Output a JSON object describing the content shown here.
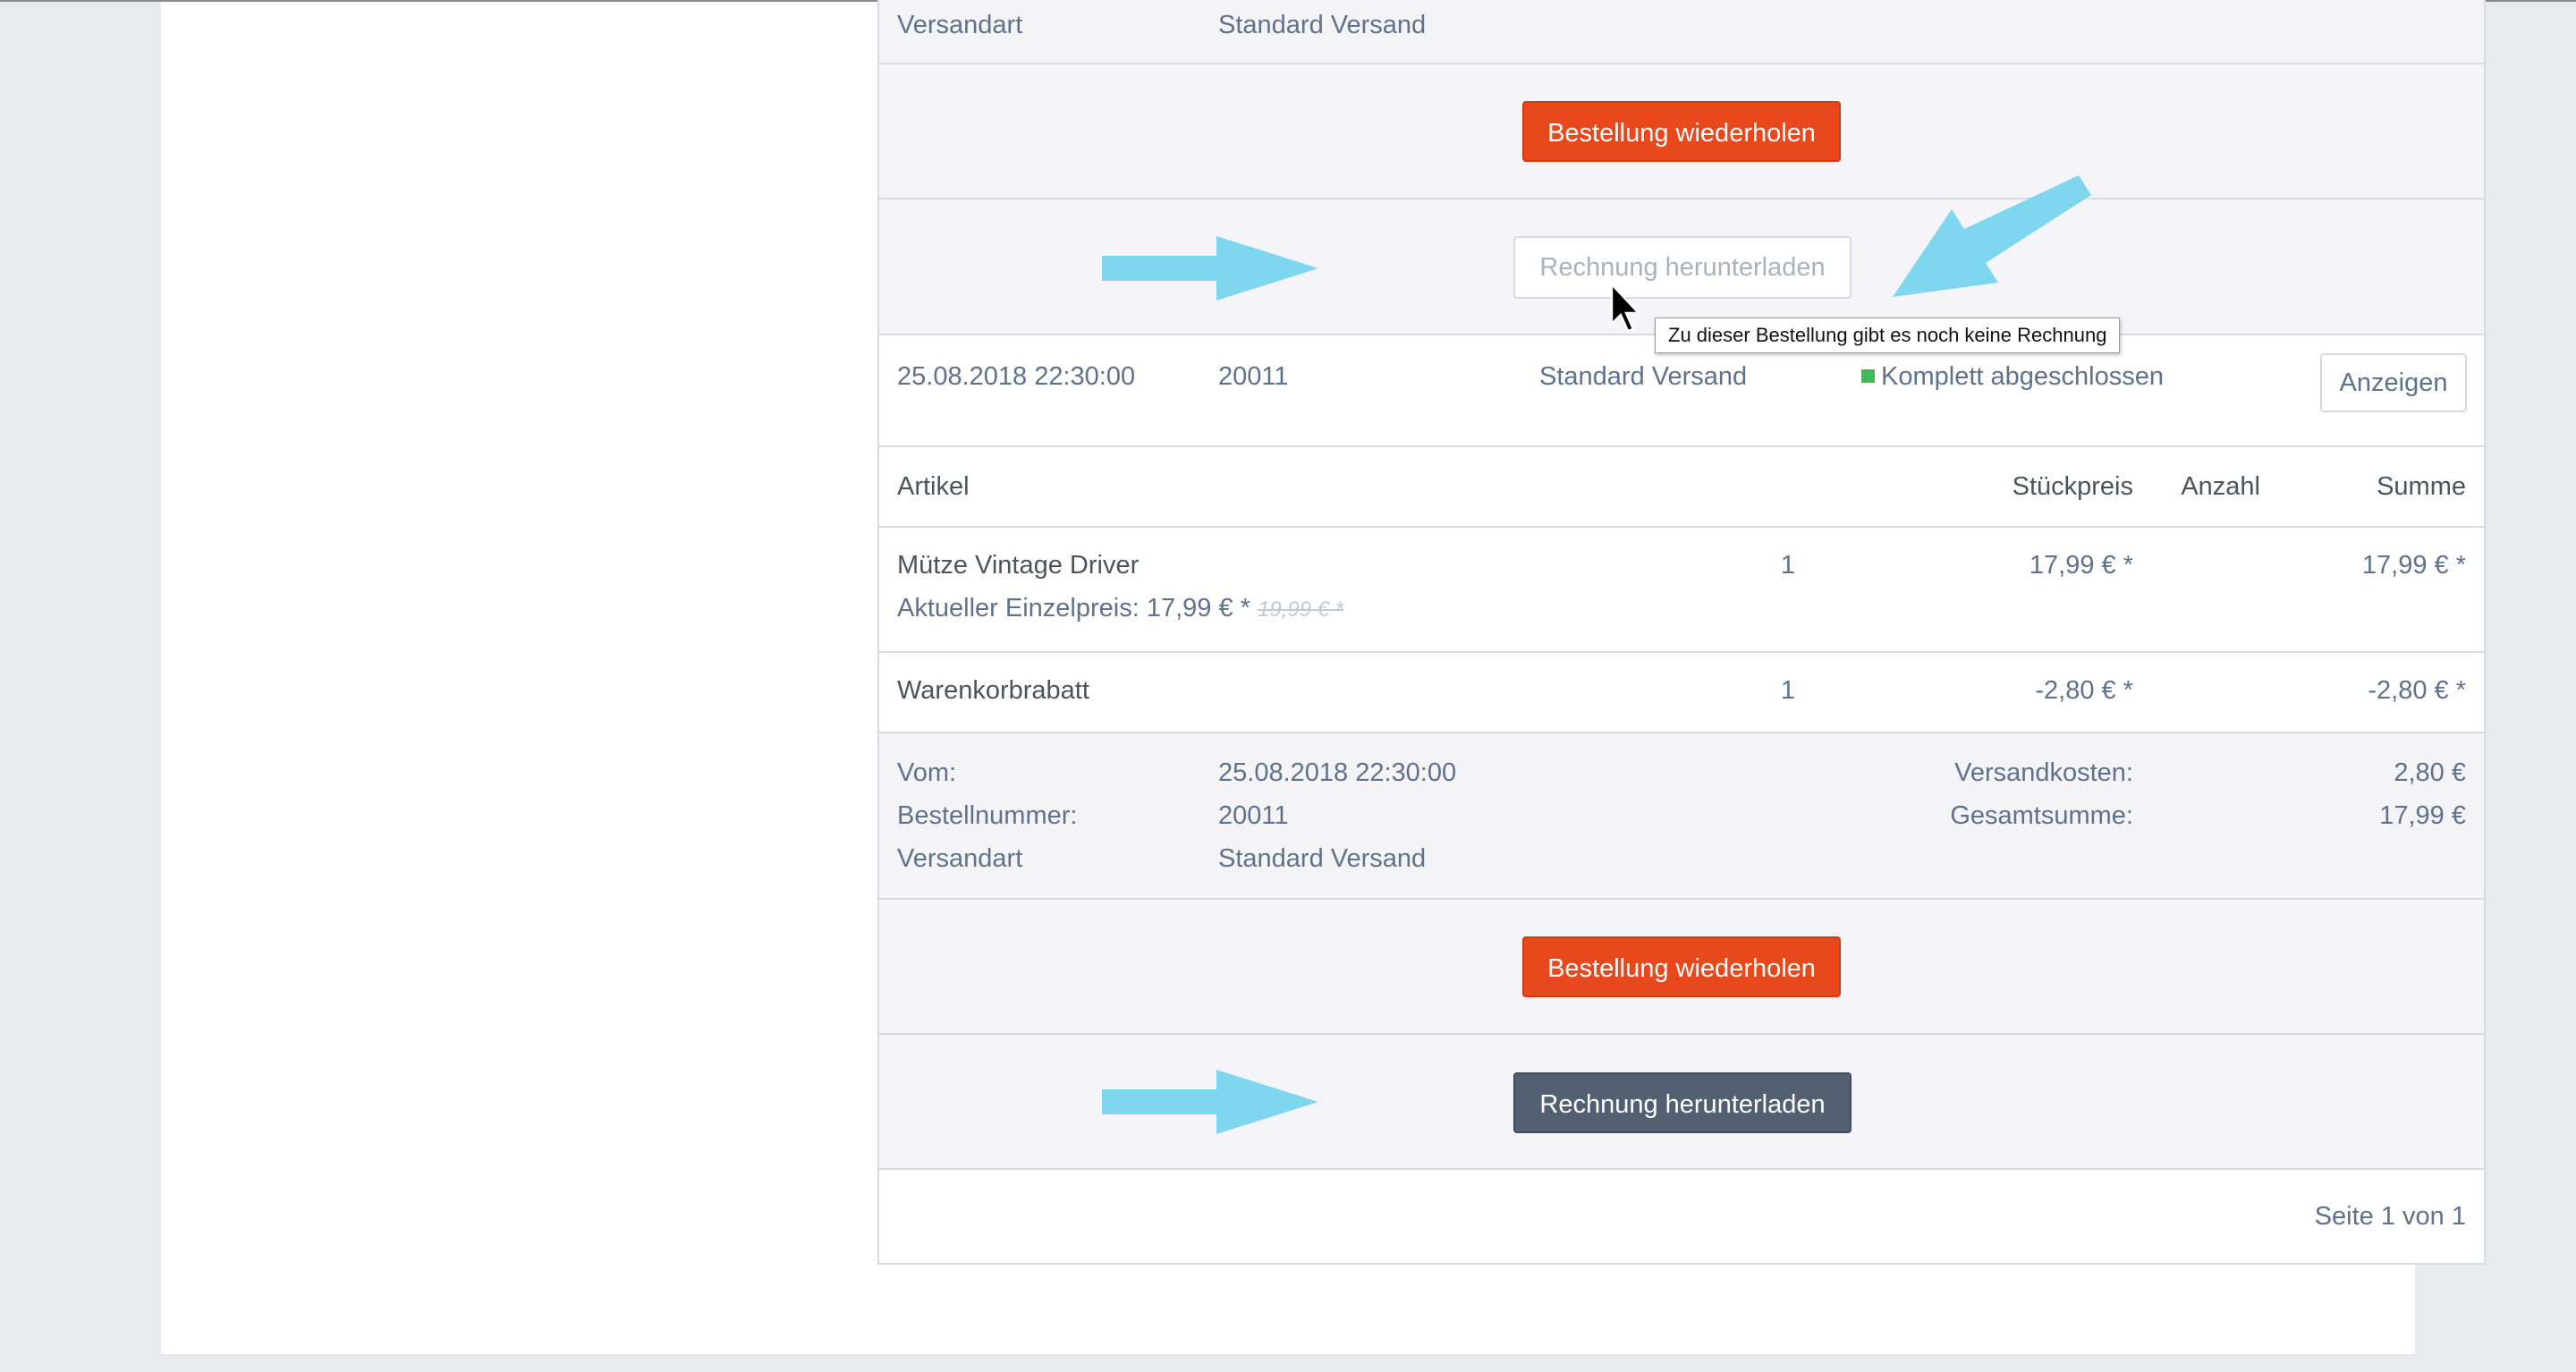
{
  "top_order": {
    "shipping_label": "Versandart",
    "shipping_value": "Standard Versand",
    "repeat_button": "Bestellung wiederholen",
    "invoice_button": "Rechnung herunterladen",
    "invoice_tooltip": "Zu dieser Bestellung gibt es noch keine Rechnung"
  },
  "order": {
    "date": "25.08.2018 22:30:00",
    "number": "20011",
    "shipping": "Standard Versand",
    "status": "Komplett abgeschlossen",
    "status_color": "#3dbb5c",
    "show_button": "Anzeigen"
  },
  "table": {
    "headers": {
      "article": "Artikel",
      "qty": "Anzahl",
      "unit_price": "Stückpreis",
      "sum": "Summe"
    },
    "rows": [
      {
        "name": "Mütze Vintage Driver",
        "current_price_label": "Aktueller Einzelpreis: 17,99 € *",
        "old_price": "19,99 € *",
        "qty": "1",
        "unit_price": "17,99 € *",
        "sum": "17,99 € *"
      },
      {
        "name": "Warenkorbrabatt",
        "qty": "1",
        "unit_price": "-2,80 € *",
        "sum": "-2,80 € *"
      }
    ]
  },
  "summary": {
    "date_label": "Vom:",
    "date_value": "25.08.2018 22:30:00",
    "number_label": "Bestellnummer:",
    "number_value": "20011",
    "shipping_label": "Versandart",
    "shipping_value": "Standard Versand",
    "shipping_cost_label": "Versandkosten:",
    "shipping_cost_value": "2,80 €",
    "total_label": "Gesamtsumme:",
    "total_value": "17,99 €"
  },
  "actions": {
    "repeat_button": "Bestellung wiederholen",
    "invoice_button": "Rechnung herunterladen"
  },
  "pagination": {
    "label": "Seite 1 von 1"
  },
  "colors": {
    "accent_orange": "#e8491c",
    "dark_button": "#526072",
    "annotation_arrow": "#7ed6ef"
  }
}
